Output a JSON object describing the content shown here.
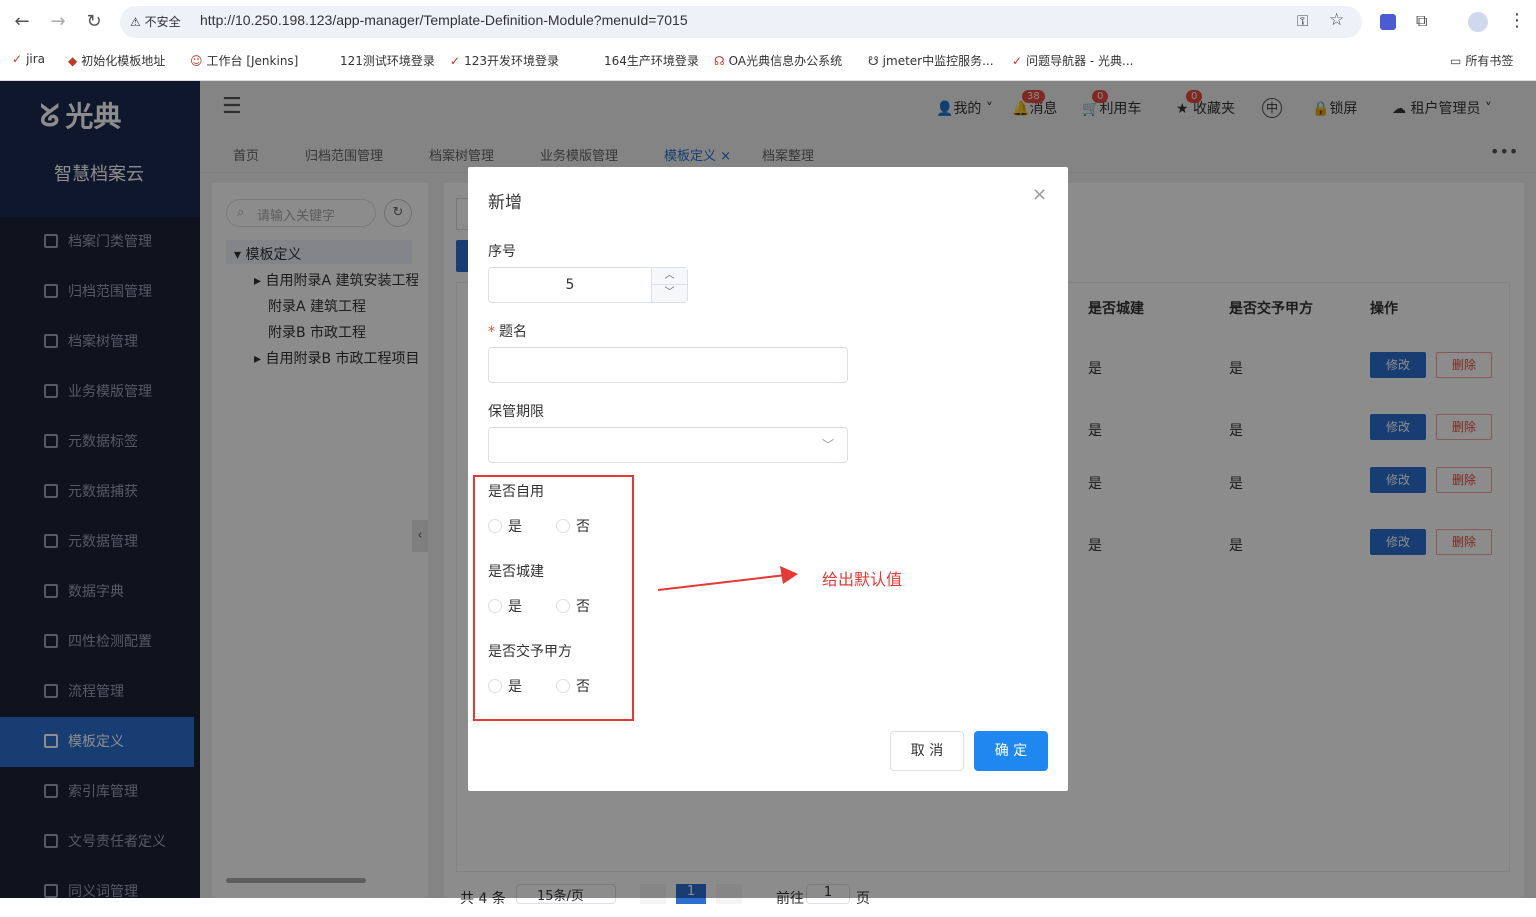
{
  "browser": {
    "insecure_label": "不安全",
    "url": "http://10.250.198.123/app-manager/Template-Definition-Module?menuId=7015",
    "bookmarks": [
      "jira",
      "初始化模板地址",
      "工作台 [Jenkins]",
      "121测试环境登录",
      "123开发环境登录",
      "164生产环境登录",
      "OA光典信息办公系统",
      "jmeter中监控服务...",
      "问题导航器 - 光典..."
    ],
    "all_bookmarks": "所有书签"
  },
  "app": {
    "logo": "光典",
    "subtitle": "智慧档案云"
  },
  "sidebar": {
    "items": [
      {
        "label": "档案门类管理"
      },
      {
        "label": "归档范围管理"
      },
      {
        "label": "档案树管理"
      },
      {
        "label": "业务模版管理"
      },
      {
        "label": "元数据标签"
      },
      {
        "label": "元数据捕获"
      },
      {
        "label": "元数据管理"
      },
      {
        "label": "数据字典"
      },
      {
        "label": "四性检测配置"
      },
      {
        "label": "流程管理"
      },
      {
        "label": "模板定义"
      },
      {
        "label": "索引库管理"
      },
      {
        "label": "文号责任者定义"
      },
      {
        "label": "同义词管理"
      }
    ]
  },
  "header": {
    "mine": "我的",
    "messages": "消息",
    "messages_count": "38",
    "cart": "利用车",
    "cart_count": "0",
    "favorites": "收藏夹",
    "favorites_count": "0",
    "lang": "中",
    "lock": "锁屏",
    "user": "租户管理员"
  },
  "tabs": [
    "首页",
    "归档范围管理",
    "档案树管理",
    "业务模版管理",
    "模板定义",
    "档案整理"
  ],
  "tree": {
    "search_placeholder": "请输入关键字",
    "root": "模板定义",
    "children": [
      "自用附录A 建筑安装工程",
      "附录A 建筑工程",
      "附录B 市政工程",
      "自用附录B 市政工程项目"
    ]
  },
  "table": {
    "headers": [
      "是否城建",
      "是否交予甲方",
      "操作"
    ],
    "rows": [
      {
        "city": "是",
        "party": "是"
      },
      {
        "city": "是",
        "party": "是"
      },
      {
        "city": "是",
        "party": "是"
      },
      {
        "city": "是",
        "party": "是"
      }
    ],
    "edit": "修改",
    "delete": "删除",
    "footer_total": "共 4 条",
    "page_size": "15条/页",
    "page": "1",
    "goto": "前往",
    "goto_page": "1",
    "page_unit": "页"
  },
  "dialog": {
    "title": "新增",
    "seq_label": "序号",
    "seq_value": "5",
    "name_label": "题名",
    "name_value": "",
    "retention_label": "保管期限",
    "retention_value": "",
    "self_use_label": "是否自用",
    "city_label": "是否城建",
    "party_label": "是否交予甲方",
    "yes": "是",
    "no": "否",
    "cancel": "取 消",
    "confirm": "确 定"
  },
  "annotation": {
    "text": "给出默认值",
    "color": "#e53935"
  }
}
